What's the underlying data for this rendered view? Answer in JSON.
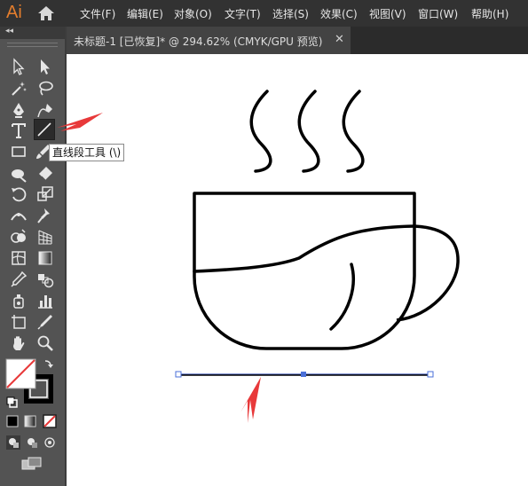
{
  "app": {
    "logo": "Ai"
  },
  "menu": [
    "文件(F)",
    "编辑(E)",
    "对象(O)",
    "文字(T)",
    "选择(S)",
    "效果(C)",
    "视图(V)",
    "窗口(W)",
    "帮助(H)"
  ],
  "document_tab": {
    "title": "未标题-1 [已恢复]* @ 294.62% (CMYK/GPU 预览)",
    "close": "✕"
  },
  "toolbar": {
    "collapse": "◂◂",
    "tools": [
      "selection-tool",
      "direct-selection-tool",
      "magic-wand-tool",
      "lasso-tool",
      "pen-tool",
      "curvature-tool",
      "type-tool",
      "line-segment-tool",
      "rectangle-tool",
      "paintbrush-tool",
      "shaper-tool",
      "eraser-tool",
      "rotate-tool",
      "scale-tool",
      "width-tool",
      "puppet-warp-tool",
      "shape-builder-tool",
      "perspective-grid-tool",
      "mesh-tool",
      "gradient-tool",
      "eyedropper-tool",
      "blend-tool",
      "symbol-sprayer-tool",
      "column-graph-tool",
      "artboard-tool",
      "slice-tool",
      "hand-tool",
      "zoom-tool"
    ],
    "active_tool": "line-segment-tool",
    "tooltip": "直线段工具 (\\)"
  },
  "colors": {
    "menubar": "#323232",
    "toolbar": "#535353",
    "accent_logo": "#e37d2d",
    "selection_blue": "#4a6fd8",
    "annotation_red": "#e8393a"
  }
}
